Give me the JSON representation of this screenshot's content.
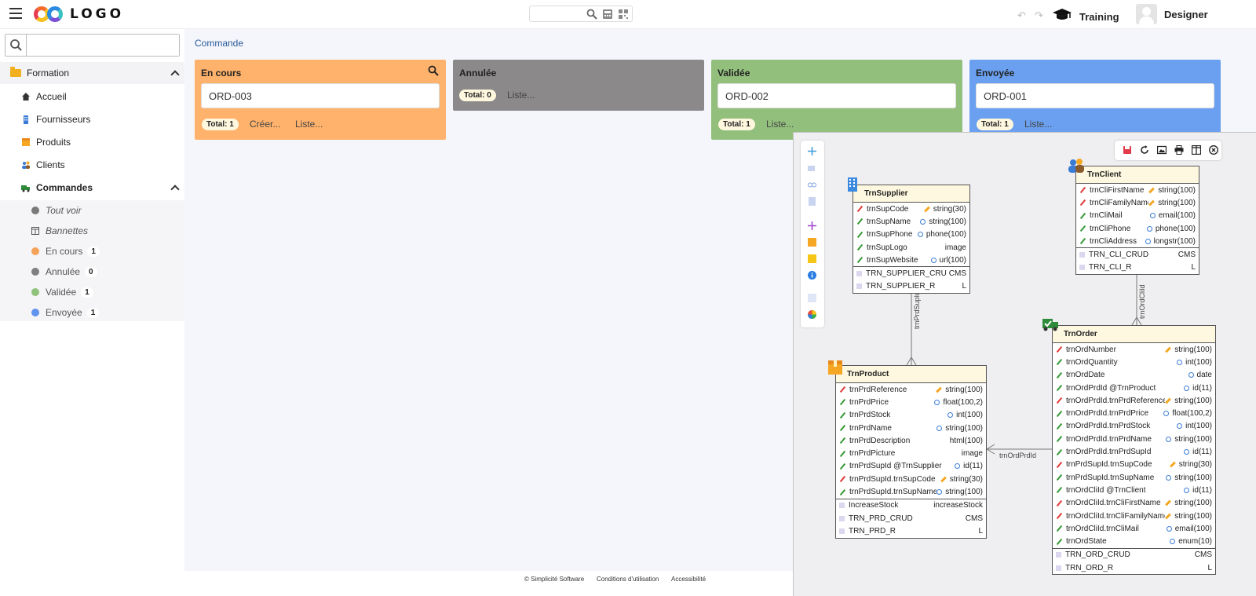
{
  "header": {
    "logo_text": "LOGO",
    "training_label": "Training",
    "user_label": "Designer"
  },
  "sidebar": {
    "search_placeholder": "",
    "domain_label": "Formation",
    "items": [
      {
        "label": "Accueil",
        "icon": "home-icon"
      },
      {
        "label": "Fournisseurs",
        "icon": "building-icon"
      },
      {
        "label": "Produits",
        "icon": "box-icon"
      },
      {
        "label": "Clients",
        "icon": "people-icon"
      },
      {
        "label": "Commandes",
        "icon": "truck-icon"
      }
    ],
    "sub_items": [
      {
        "label": "Tout voir",
        "color": "#7a7a7a",
        "count": ""
      },
      {
        "label": "Bannettes",
        "color": "",
        "count": ""
      },
      {
        "label": "En cours",
        "color": "#f5a25a",
        "count": "1"
      },
      {
        "label": "Annulée",
        "color": "#7f7f7f",
        "count": "0"
      },
      {
        "label": "Validée",
        "color": "#8fc27a",
        "count": "1"
      },
      {
        "label": "Envoyée",
        "color": "#5f93ee",
        "count": "1"
      }
    ]
  },
  "main": {
    "breadcrumb": "Commande",
    "columns": [
      {
        "title": "En cours",
        "color": "#ffb26b",
        "card": "ORD-003",
        "total": "Total: 1",
        "create": "Créer...",
        "list": "Liste..."
      },
      {
        "title": "Annulée",
        "color": "#8b898a",
        "card": "",
        "total": "Total: 0",
        "create": "",
        "list": "Liste..."
      },
      {
        "title": "Validée",
        "color": "#93bf7d",
        "card": "ORD-002",
        "total": "Total: 1",
        "create": "",
        "list": "Liste..."
      },
      {
        "title": "Envoyée",
        "color": "#6aa0ef",
        "card": "ORD-001",
        "total": "Total: 1",
        "create": "",
        "list": "Liste..."
      }
    ]
  },
  "footer": {
    "copyright": "© Simplicité Software",
    "terms": "Conditions d'utilisation",
    "accessibility": "Accessibilité"
  },
  "model": {
    "relations": {
      "prd_sup": "trnPrdSupId",
      "ord_cli": "trnOrdCliId",
      "ord_prd": "trnOrdPrdId"
    },
    "supplier": {
      "name": "TrnSupplier",
      "fields": [
        {
          "n": "trnSupCode",
          "t": "string(30)",
          "k": "key"
        },
        {
          "n": "trnSupName",
          "t": "string(100)",
          "k": "search"
        },
        {
          "n": "trnSupPhone",
          "t": "phone(100)",
          "k": "search"
        },
        {
          "n": "trnSupLogo",
          "t": "image",
          "k": ""
        },
        {
          "n": "trnSupWebsite",
          "t": "url(100)",
          "k": "search"
        }
      ],
      "actions": [
        {
          "n": "TRN_SUPPLIER_CRUD",
          "t": "CMS"
        },
        {
          "n": "TRN_SUPPLIER_R",
          "t": "L"
        }
      ]
    },
    "client": {
      "name": "TrnClient",
      "fields": [
        {
          "n": "trnCliFirstName",
          "t": "string(100)",
          "k": "key"
        },
        {
          "n": "trnCliFamilyName",
          "t": "string(100)",
          "k": "key"
        },
        {
          "n": "trnCliMail",
          "t": "email(100)",
          "k": "search"
        },
        {
          "n": "trnCliPhone",
          "t": "phone(100)",
          "k": "search"
        },
        {
          "n": "trnCliAddress",
          "t": "longstr(100)",
          "k": "search"
        }
      ],
      "actions": [
        {
          "n": "TRN_CLI_CRUD",
          "t": "CMS"
        },
        {
          "n": "TRN_CLI_R",
          "t": "L"
        }
      ]
    },
    "product": {
      "name": "TrnProduct",
      "fields": [
        {
          "n": "trnPrdReference",
          "t": "string(100)",
          "k": "key"
        },
        {
          "n": "trnPrdPrice",
          "t": "float(100,2)",
          "k": "search"
        },
        {
          "n": "trnPrdStock",
          "t": "int(100)",
          "k": "search"
        },
        {
          "n": "trnPrdName",
          "t": "string(100)",
          "k": "search"
        },
        {
          "n": "trnPrdDescription",
          "t": "html(100)",
          "k": ""
        },
        {
          "n": "trnPrdPicture",
          "t": "image",
          "k": ""
        },
        {
          "n": "trnPrdSupId @TrnSupplier",
          "t": "id(11)",
          "k": "search"
        },
        {
          "n": "trnPrdSupId.trnSupCode",
          "t": "string(30)",
          "k": "key"
        },
        {
          "n": "trnPrdSupId.trnSupName",
          "t": "string(100)",
          "k": "search"
        }
      ],
      "actions": [
        {
          "n": "IncreaseStock",
          "t": "increaseStock"
        },
        {
          "n": "TRN_PRD_CRUD",
          "t": "CMS"
        },
        {
          "n": "TRN_PRD_R",
          "t": "L"
        }
      ]
    },
    "order": {
      "name": "TrnOrder",
      "fields": [
        {
          "n": "trnOrdNumber",
          "t": "string(100)",
          "k": "key"
        },
        {
          "n": "trnOrdQuantity",
          "t": "int(100)",
          "k": "search"
        },
        {
          "n": "trnOrdDate",
          "t": "date",
          "k": "search"
        },
        {
          "n": "trnOrdPrdId @TrnProduct",
          "t": "id(11)",
          "k": "search"
        },
        {
          "n": "trnOrdPrdId.trnPrdReference",
          "t": "string(100)",
          "k": "key"
        },
        {
          "n": "trnOrdPrdId.trnPrdPrice",
          "t": "float(100,2)",
          "k": "search"
        },
        {
          "n": "trnOrdPrdId.trnPrdStock",
          "t": "int(100)",
          "k": "search"
        },
        {
          "n": "trnOrdPrdId.trnPrdName",
          "t": "string(100)",
          "k": "search"
        },
        {
          "n": "trnOrdPrdId.trnPrdSupId",
          "t": "id(11)",
          "k": "search"
        },
        {
          "n": "trnPrdSupId.trnSupCode",
          "t": "string(30)",
          "k": "key"
        },
        {
          "n": "trnPrdSupId.trnSupName",
          "t": "string(100)",
          "k": "search"
        },
        {
          "n": "trnOrdCliId @TrnClient",
          "t": "id(11)",
          "k": "search"
        },
        {
          "n": "trnOrdCliId.trnCliFirstName",
          "t": "string(100)",
          "k": "key"
        },
        {
          "n": "trnOrdCliId.trnCliFamilyName",
          "t": "string(100)",
          "k": "key"
        },
        {
          "n": "trnOrdCliId.trnCliMail",
          "t": "email(100)",
          "k": "search"
        },
        {
          "n": "trnOrdState",
          "t": "enum(10)",
          "k": "search"
        }
      ],
      "actions": [
        {
          "n": "TRN_ORD_CRUD",
          "t": "CMS"
        },
        {
          "n": "TRN_ORD_R",
          "t": "L"
        }
      ]
    }
  }
}
